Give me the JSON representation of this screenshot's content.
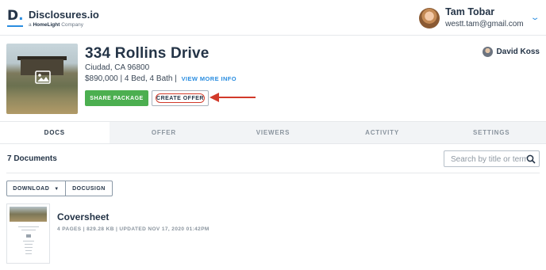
{
  "brand": {
    "mark": "D",
    "name": "Disclosures.io",
    "tagline_prefix": "a",
    "tagline_company": "HomeLight",
    "tagline_suffix": "Company"
  },
  "user": {
    "name": "Tam Tobar",
    "email": "westt.tam@gmail.com"
  },
  "property": {
    "title": "334 Rollins Drive",
    "city": "Ciudad, CA 96800",
    "details": "$890,000 | 4 Bed, 4 Bath |",
    "view_more": "VIEW MORE INFO",
    "share_label": "SHARE PACKAGE",
    "offer_label": "CREATE OFFER",
    "agent_name": "David Koss"
  },
  "tabs": [
    {
      "label": "DOCS",
      "active": true
    },
    {
      "label": "OFFER",
      "active": false
    },
    {
      "label": "VIEWERS",
      "active": false
    },
    {
      "label": "ACTIVITY",
      "active": false
    },
    {
      "label": "SETTINGS",
      "active": false
    }
  ],
  "documents": {
    "count_label": "7 Documents",
    "search_placeholder": "Search by title or term",
    "download_label": "DOWNLOAD",
    "docusign_label": "DOCUSIGN",
    "items": [
      {
        "title": "Coversheet",
        "meta": "4 PAGES | 829.28 KB | UPDATED NOV 17, 2020 01:42PM"
      }
    ]
  },
  "colors": {
    "accent": "#2a8de0",
    "share_green": "#4caf50",
    "annotation_red": "#d23a2a",
    "heading": "#243447"
  },
  "icons": {
    "image": "image-icon",
    "search": "search-icon",
    "chevron": "chevron-down-icon",
    "caret": "caret-down-icon",
    "arrow": "annotation-arrow-icon"
  }
}
